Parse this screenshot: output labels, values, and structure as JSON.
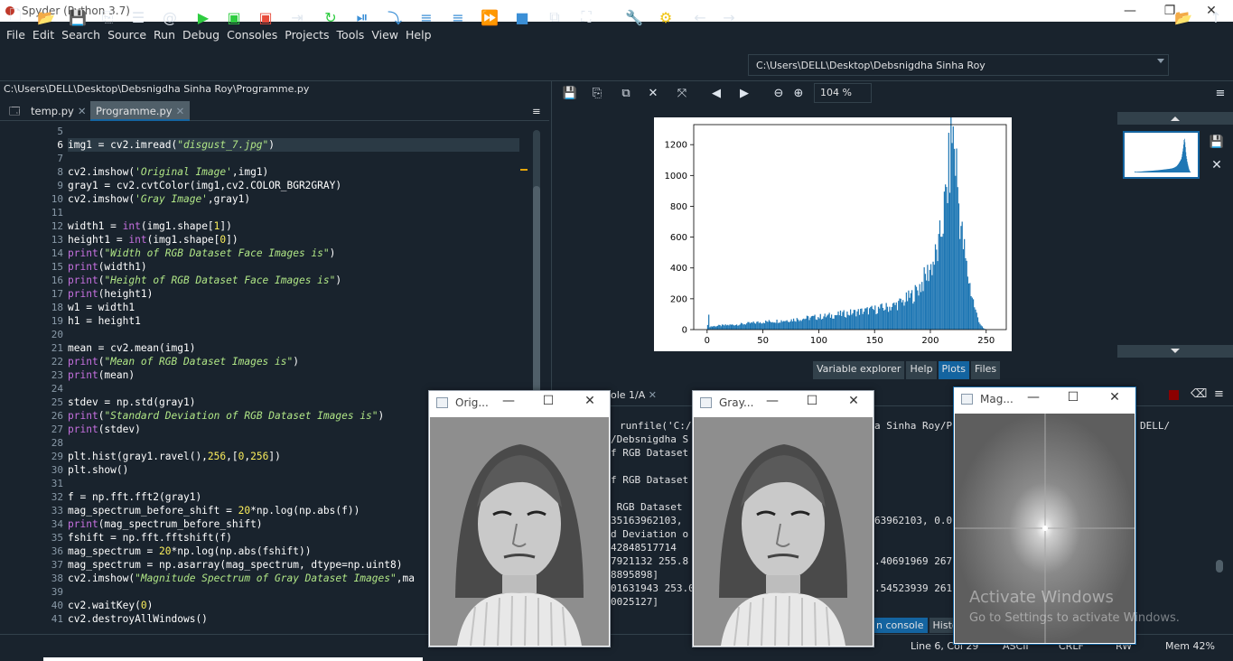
{
  "window": {
    "title": "Spyder (Python 3.7)"
  },
  "menu": [
    "File",
    "Edit",
    "Search",
    "Source",
    "Run",
    "Debug",
    "Consoles",
    "Projects",
    "Tools",
    "View",
    "Help"
  ],
  "toolbar": {
    "working_dir": "C:\\Users\\DELL\\Desktop\\Debsnigdha Sinha Roy"
  },
  "editor": {
    "file_path": "C:\\Users\\DELL\\Desktop\\Debsnigdha Sinha Roy\\Programme.py",
    "tabs": [
      {
        "label": "temp.py"
      },
      {
        "label": "Programme.py"
      }
    ],
    "line_numbers": [
      "5",
      "6",
      "7",
      "8",
      "9",
      "10",
      "11",
      "12",
      "13",
      "14",
      "15",
      "16",
      "17",
      "18",
      "19",
      "20",
      "21",
      "22",
      "23",
      "24",
      "25",
      "26",
      "27",
      "28",
      "29",
      "30",
      "31",
      "32",
      "33",
      "34",
      "35",
      "36",
      "37",
      "38",
      "39",
      "40",
      "41"
    ],
    "lines": [
      "",
      "img1 = cv2.imread(\"disgust_7.jpg\")",
      "",
      "cv2.imshow('Original Image',img1)",
      "gray1 = cv2.cvtColor(img1,cv2.COLOR_BGR2GRAY)",
      "cv2.imshow('Gray Image',gray1)",
      "",
      "width1 = int(img1.shape[1])",
      "height1 = int(img1.shape[0])",
      "print(\"Width of RGB Dataset Face Images is\")",
      "print(width1)",
      "print(\"Height of RGB Dataset Face Images is\")",
      "print(height1)",
      "w1 = width1",
      "h1 = height1",
      "",
      "mean = cv2.mean(img1)",
      "print(\"Mean of RGB Dataset Images is\")",
      "print(mean)",
      "",
      "stdev = np.std(gray1)",
      "print(\"Standard Deviation of RGB Dataset Images is\")",
      "print(stdev)",
      "",
      "plt.hist(gray1.ravel(),256,[0,256])",
      "plt.show()",
      "",
      "f = np.fft.fft2(gray1)",
      "mag_spectrum_before_shift = 20*np.log(np.abs(f))",
      "print(mag_spectrum_before_shift)",
      "fshift = np.fft.fftshift(f)",
      "mag_spectrum = 20*np.log(np.abs(fshift))",
      "mag_spectrum = np.asarray(mag_spectrum, dtype=np.uint8)",
      "cv2.imshow(\"Magnitude Spectrum of Gray Dataset Images\",ma",
      "",
      "cv2.waitKey(0)",
      "cv2.destroyAllWindows()"
    ]
  },
  "plots": {
    "zoom": "104 %"
  },
  "pane_tabs": [
    "Variable explorer",
    "Help",
    "Plots",
    "Files"
  ],
  "console": {
    "tab_label": "ole 1/A",
    "lines": [
      {
        "text": "runfile('C:/",
        "x": 686,
        "y": 465
      },
      {
        "text": "/Debsnigdha S",
        "x": 676,
        "y": 480
      },
      {
        "text": "f RGB Dataset",
        "x": 676,
        "y": 495
      },
      {
        "text": "f RGB Dataset",
        "x": 676,
        "y": 525
      },
      {
        "text": " RGB Dataset",
        "x": 676,
        "y": 555
      },
      {
        "text": "35163962103,",
        "x": 676,
        "y": 570
      },
      {
        "text": "d Deviation o",
        "x": 676,
        "y": 585
      },
      {
        "text": "42848517714",
        "x": 676,
        "y": 600
      },
      {
        "text": "7921132 255.8",
        "x": 676,
        "y": 615
      },
      {
        "text": "8895898]",
        "x": 676,
        "y": 630
      },
      {
        "text": "01631943 253.0",
        "x": 676,
        "y": 645
      },
      {
        "text": "0025127]",
        "x": 676,
        "y": 660
      },
      {
        "text": "a Sinha Roy/P",
        "x": 968,
        "y": 465
      },
      {
        "text": "63962103, 0.0",
        "x": 968,
        "y": 570
      },
      {
        "text": ".40691969 267",
        "x": 968,
        "y": 615
      },
      {
        "text": ".54523939 261",
        "x": 968,
        "y": 645
      },
      {
        "text": "DELL/",
        "x": 1262,
        "y": 465
      }
    ]
  },
  "bottom_tabs": [
    "n console",
    "History"
  ],
  "status": {
    "position": "Line 6, Col 29",
    "encoding": "ASCII",
    "eol": "CRLF",
    "perm": "RW",
    "mem": "Mem 42%"
  },
  "windows": [
    {
      "title": "Orig..."
    },
    {
      "title": "Gray..."
    },
    {
      "title": "Mag..."
    }
  ],
  "watermark": {
    "line1": "Activate Windows",
    "line2": "Go to Settings to activate Windows."
  },
  "chart_data": {
    "type": "bar",
    "title": "",
    "xlabel": "",
    "ylabel": "",
    "xlim": [
      -12,
      268
    ],
    "ylim": [
      0,
      1330
    ],
    "xticks": [
      0,
      50,
      100,
      150,
      200,
      250
    ],
    "yticks": [
      0,
      200,
      400,
      600,
      800,
      1000,
      1200
    ],
    "bin_count": 256,
    "color": "#1f77b4",
    "anchors": [
      [
        0,
        40
      ],
      [
        1,
        80
      ],
      [
        2,
        20
      ],
      [
        10,
        25
      ],
      [
        30,
        35
      ],
      [
        50,
        50
      ],
      [
        70,
        60
      ],
      [
        90,
        75
      ],
      [
        110,
        90
      ],
      [
        130,
        110
      ],
      [
        150,
        130
      ],
      [
        165,
        150
      ],
      [
        175,
        180
      ],
      [
        185,
        230
      ],
      [
        192,
        300
      ],
      [
        198,
        380
      ],
      [
        203,
        450
      ],
      [
        207,
        520
      ],
      [
        210,
        680
      ],
      [
        213,
        820
      ],
      [
        215,
        950
      ],
      [
        217,
        1100
      ],
      [
        219,
        1300
      ],
      [
        221,
        1180
      ],
      [
        223,
        1050
      ],
      [
        225,
        820
      ],
      [
        228,
        600
      ],
      [
        232,
        400
      ],
      [
        236,
        250
      ],
      [
        240,
        120
      ],
      [
        244,
        40
      ],
      [
        247,
        8
      ],
      [
        250,
        0
      ],
      [
        255,
        0
      ]
    ]
  }
}
